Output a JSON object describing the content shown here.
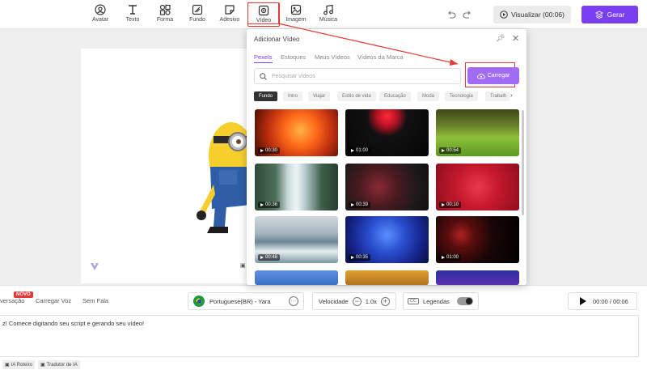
{
  "toolbar": {
    "items": [
      {
        "label": "Avatar",
        "icon": "avatar-icon"
      },
      {
        "label": "Texto",
        "icon": "text-icon"
      },
      {
        "label": "Forma",
        "icon": "shape-icon"
      },
      {
        "label": "Fundo",
        "icon": "background-icon"
      },
      {
        "label": "Adesivo",
        "icon": "sticker-icon"
      },
      {
        "label": "Vídeo",
        "icon": "video-icon",
        "active": true
      },
      {
        "label": "Imagem",
        "icon": "image-icon"
      },
      {
        "label": "Música",
        "icon": "music-icon"
      }
    ],
    "preview_label": "Visualizar (00:06)",
    "generate_label": "Gerar",
    "accent": "#7b3ff2"
  },
  "popup": {
    "title": "Adicionar Vídeo",
    "tabs": [
      "Pexels",
      "Estoques",
      "Meus Vídeos",
      "Vídeos da Marca"
    ],
    "search_placeholder": "Pesquisar vídeos",
    "upload_label": "Carregar",
    "categories": [
      "Fundo",
      "Intro",
      "Viajar",
      "Estilo de vida",
      "Educação",
      "Moda",
      "Tecnologia",
      "Trabalh"
    ],
    "videos": [
      {
        "duration": "00:30",
        "theme": "fire"
      },
      {
        "duration": "01:00",
        "theme": "red-ink"
      },
      {
        "duration": "00:54",
        "theme": "grass"
      },
      {
        "duration": "00:36",
        "theme": "waterfall"
      },
      {
        "duration": "00:39",
        "theme": "red-smoke"
      },
      {
        "duration": "00:10",
        "theme": "red-glitter"
      },
      {
        "duration": "00:48",
        "theme": "ocean"
      },
      {
        "duration": "00:35",
        "theme": "blue-lights"
      },
      {
        "duration": "01:00",
        "theme": "bokeh"
      }
    ]
  },
  "bottom": {
    "tabs": [
      "versação",
      "Carregar Voz",
      "Sem Fala"
    ],
    "novo_badge": "NOVO",
    "voice": "Portuguese(BR) - Yara",
    "speed_label": "Velocidade",
    "speed_value": "1.0x",
    "subtitles_label": "Legendas",
    "time": "00:00 / 00:06",
    "script_text": "z! Comece digitando seu script e gerando seu vídeo!",
    "chips": [
      "IA Roteiro",
      "Tradutor de IA"
    ]
  }
}
